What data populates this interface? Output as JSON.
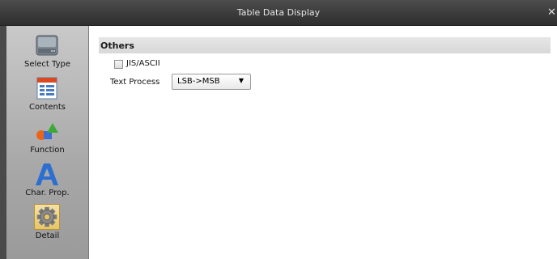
{
  "window": {
    "title": "Table Data Display",
    "close_glyph": "✕"
  },
  "sidebar": {
    "items": [
      {
        "label": "Select Type",
        "icon": "drive-icon"
      },
      {
        "label": "Contents",
        "icon": "contents-icon"
      },
      {
        "label": "Function",
        "icon": "shapes-icon"
      },
      {
        "label": "Char. Prop.",
        "icon": "letter-a-icon"
      },
      {
        "label": "Detail",
        "icon": "gear-icon",
        "selected": true
      }
    ]
  },
  "section": {
    "title": "Others"
  },
  "options": {
    "jis_ascii_label": "JIS/ASCII",
    "jis_ascii_checked": false,
    "text_process_label": "Text Process",
    "text_process_value": "LSB->MSB"
  }
}
